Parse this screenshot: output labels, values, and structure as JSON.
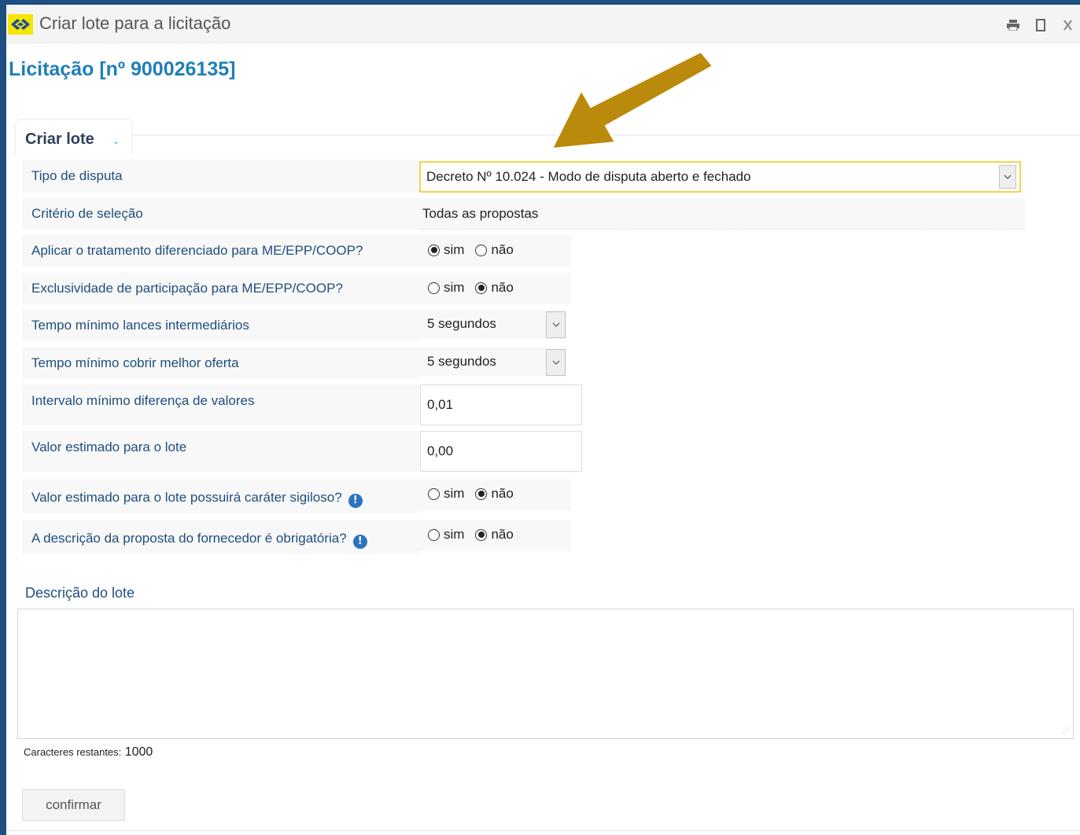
{
  "window": {
    "title": "Criar lote para a licitação"
  },
  "page": {
    "heading": "Licitação [nº 900026135]"
  },
  "tab": {
    "label": "Criar lote"
  },
  "form": {
    "tipo_disputa": {
      "label": "Tipo de disputa",
      "value": "Decreto Nº 10.024 - Modo de disputa aberto e fechado"
    },
    "criterio_selecao": {
      "label": "Critério de seleção",
      "value": "Todas as propostas"
    },
    "tratamento_diferenciado": {
      "label": "Aplicar o tratamento diferenciado para ME/EPP/COOP?",
      "option_yes": "sim",
      "option_no": "não",
      "selected": "sim"
    },
    "exclusividade": {
      "label": "Exclusividade de participação para ME/EPP/COOP?",
      "option_yes": "sim",
      "option_no": "não",
      "selected": "não"
    },
    "tempo_lances": {
      "label": "Tempo mínimo lances intermediários",
      "value": "5 segundos"
    },
    "tempo_cobrir": {
      "label": "Tempo mínimo cobrir melhor oferta",
      "value": "5 segundos"
    },
    "intervalo_diferenca": {
      "label": "Intervalo mínimo diferença de valores",
      "value": "0,01"
    },
    "valor_estimado": {
      "label": "Valor estimado para o lote",
      "value": "0,00"
    },
    "sigiloso": {
      "label": "Valor estimado para o lote possuirá caráter sigiloso?",
      "option_yes": "sim",
      "option_no": "não",
      "selected": "não"
    },
    "descricao_obrigatoria": {
      "label": "A descrição da proposta do fornecedor é obrigatória?",
      "option_yes": "sim",
      "option_no": "não",
      "selected": "não"
    },
    "descricao_lote": {
      "label": "Descrição do lote",
      "value": "",
      "counter_label": "Caracteres restantes:",
      "counter_value": "1000"
    },
    "confirm_label": "confirmar"
  },
  "colors": {
    "frame": "#1d4f80",
    "heading": "#1f7fb7",
    "label": "#1f4e7d",
    "arrow": "#b98a0b",
    "select_focus": "#f3d44d"
  },
  "icons": [
    "bb-logo-icon",
    "print-icon",
    "maximize-icon",
    "close-icon",
    "chevron-down-icon",
    "info-icon",
    "pointer-arrow"
  ]
}
